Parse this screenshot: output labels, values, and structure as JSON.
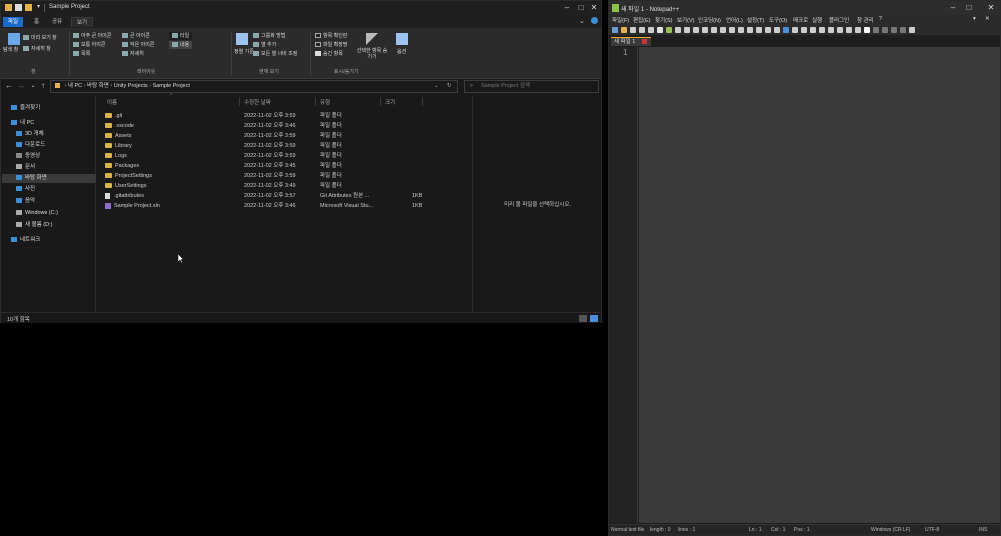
{
  "explorer": {
    "window_title": "Sample Project",
    "ribbon_tabs": [
      "파일",
      "홈",
      "공유",
      "보기"
    ],
    "ribbon": {
      "col_nav_pane": "탐색 창",
      "col_preview": "미리 보기 창",
      "col_details": "자세히 창",
      "layout_items": [
        "아주 큰 아이콘",
        "큰 아이콘",
        "보통 아이콘",
        "작은 아이콘",
        "목록",
        "자세히",
        "타일",
        "내용"
      ],
      "sort_label": "정렬 기준",
      "group_label": "그룹화 방법",
      "add_columns": "열 추가",
      "fit_columns": "모든 열 너비 조정",
      "checkboxes": "항목 확인란",
      "extensions": "파일 확장명",
      "hidden_items": "숨긴 항목",
      "hide_selected": "선택한 항목 숨기기",
      "options": "옵션",
      "group_labels": [
        "창",
        "레이아웃",
        "현재 보기",
        "표시/숨기기"
      ]
    },
    "address": {
      "segments": [
        "내 PC",
        "바탕 화면",
        "Unity Projects",
        "Sample Project"
      ],
      "search_placeholder": "Sample Project 검색"
    },
    "nav": [
      {
        "label": "즐겨찾기",
        "icon": "star-icon",
        "color": "#3b8fd9"
      },
      {
        "label": "내 PC",
        "icon": "pc-icon",
        "color": "#3b8fd9"
      },
      {
        "label": "3D 개체",
        "icon": "cube-icon",
        "color": "#3b8fd9"
      },
      {
        "label": "다운로드",
        "icon": "download-icon",
        "color": "#3b8fd9"
      },
      {
        "label": "동영상",
        "icon": "video-icon",
        "color": "#888"
      },
      {
        "label": "문서",
        "icon": "document-icon",
        "color": "#aaa"
      },
      {
        "label": "바탕 화면",
        "icon": "desktop-icon",
        "color": "#3b8fd9"
      },
      {
        "label": "사진",
        "icon": "picture-icon",
        "color": "#3b8fd9"
      },
      {
        "label": "음악",
        "icon": "music-icon",
        "color": "#3b8fd9"
      },
      {
        "label": "Windows (C:)",
        "icon": "drive-icon",
        "color": "#aaa"
      },
      {
        "label": "새 볼륨 (D:)",
        "icon": "drive-icon",
        "color": "#aaa"
      },
      {
        "label": "네트워크",
        "icon": "network-icon",
        "color": "#3b8fd9"
      }
    ],
    "columns": {
      "name": "이름",
      "date": "수정한 날짜",
      "type": "유형",
      "size": "크기"
    },
    "files": [
      {
        "name": ".git",
        "date": "2022-11-02 오후 3:59",
        "type": "파일 폴더",
        "size": "",
        "kind": "folder"
      },
      {
        "name": ".vscode",
        "date": "2022-11-02 오후 3:46",
        "type": "파일 폴더",
        "size": "",
        "kind": "folder"
      },
      {
        "name": "Assets",
        "date": "2022-11-02 오후 3:59",
        "type": "파일 폴더",
        "size": "",
        "kind": "folder"
      },
      {
        "name": "Library",
        "date": "2022-11-02 오후 3:59",
        "type": "파일 폴더",
        "size": "",
        "kind": "folder"
      },
      {
        "name": "Logs",
        "date": "2022-11-02 오후 3:59",
        "type": "파일 폴더",
        "size": "",
        "kind": "folder"
      },
      {
        "name": "Packages",
        "date": "2022-11-02 오후 3:45",
        "type": "파일 폴더",
        "size": "",
        "kind": "folder"
      },
      {
        "name": "ProjectSettings",
        "date": "2022-11-02 오후 3:59",
        "type": "파일 폴더",
        "size": "",
        "kind": "folder"
      },
      {
        "name": "UserSettings",
        "date": "2022-11-02 오후 3:49",
        "type": "파일 폴더",
        "size": "",
        "kind": "folder"
      },
      {
        "name": ".gitattributes",
        "date": "2022-11-02 오후 3:57",
        "type": "Git Attributes 원본 ...",
        "size": "1KB",
        "kind": "file"
      },
      {
        "name": "Sample Project.sln",
        "date": "2022-11-02 오후 3:46",
        "type": "Microsoft Visual Stu...",
        "size": "1KB",
        "kind": "vs"
      }
    ],
    "preview_message": "미리 볼 파일을 선택하십시오.",
    "status": "10개 항목"
  },
  "notepad": {
    "window_title": "새 파일 1 - Notepad++",
    "menu": [
      "파일(F)",
      "편집(E)",
      "찾기(S)",
      "보기(V)",
      "인코딩(N)",
      "언어(L)",
      "설정(T)",
      "도구(O)",
      "매크로",
      "실행",
      "플러그인",
      "창 관리",
      "?"
    ],
    "tab": "새 파일 1",
    "line_number": "1",
    "status": {
      "type": "Normal text file",
      "length": "length : 0",
      "lines": "lines : 1",
      "ln": "Ln : 1",
      "col": "Col : 1",
      "pos": "Pos : 1",
      "eol": "Windows (CR LF)",
      "enc": "UTF-8",
      "mode": "INS"
    },
    "toolbar_colors": [
      "#6da0d9",
      "#e3b24a",
      "#cccccc",
      "#cccccc",
      "#cccccc",
      "#e0e0e0",
      "#9bbd5a",
      "#cccccc",
      "#cccccc",
      "#cccccc",
      "#cccccc",
      "#cccccc",
      "#cccccc",
      "#cccccc",
      "#cccccc",
      "#cccccc",
      "#cccccc",
      "#cccccc",
      "#cccccc",
      "#4a8fdc",
      "#cccccc",
      "#cccccc",
      "#d0d0d0",
      "#cccccc",
      "#cccccc",
      "#cccccc",
      "#cccccc",
      "#cccccc",
      "#ffffff",
      "#777777",
      "#777777",
      "#777777",
      "#777777",
      "#cccccc"
    ]
  }
}
